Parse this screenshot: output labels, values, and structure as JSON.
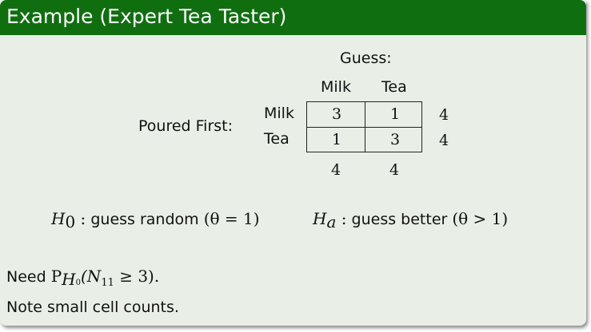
{
  "title": "Example (Expert Tea Taster)",
  "guess_label": "Guess:",
  "col_headers": [
    "Milk",
    "Tea"
  ],
  "row_group_label": "Poured First:",
  "row_headers": [
    "Milk",
    "Tea"
  ],
  "cells": [
    [
      "3",
      "1"
    ],
    [
      "1",
      "3"
    ]
  ],
  "row_totals": [
    "4",
    "4"
  ],
  "col_totals": [
    "4",
    "4"
  ],
  "h0": {
    "sym": "H",
    "sub": "0",
    "text": " guess random ",
    "cond": "(θ = 1)"
  },
  "ha": {
    "sym": "H",
    "sub": "a",
    "text": " guess better ",
    "cond": "(θ > 1)"
  },
  "need_prefix": "Need ",
  "need_math": "(N",
  "need_math_sub": "11",
  "need_math_tail": " ≥ 3).",
  "note": "Note small cell counts."
}
